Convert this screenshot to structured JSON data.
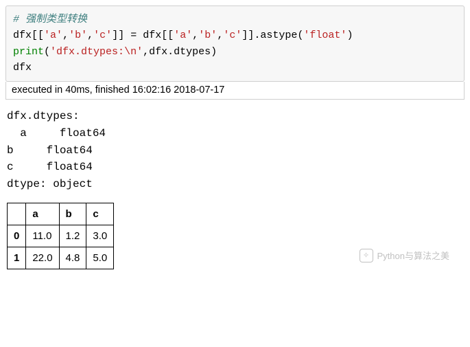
{
  "code": {
    "comment": "# 强制类型转换",
    "line2_pre": "dfx[[",
    "q": "'",
    "a": "a",
    "b": "b",
    "c": "c",
    "sep": ",",
    "line2_mid": "]] = dfx[[",
    "line2_end": "]].astype(",
    "float": "float",
    "rparen": ")",
    "print": "print",
    "lparen": "(",
    "str1": "dfx.dtypes:\\n",
    "comma_arg": ",dfx.dtypes)",
    "line4": "dfx"
  },
  "exec_status": "executed in 40ms, finished 16:02:16 2018-07-17",
  "output_text": "dfx.dtypes:\n  a     float64\nb     float64\nc     float64\ndtype: object",
  "chart_data": {
    "type": "table",
    "columns": [
      "a",
      "b",
      "c"
    ],
    "index": [
      "0",
      "1"
    ],
    "rows": [
      [
        "11.0",
        "1.2",
        "3.0"
      ],
      [
        "22.0",
        "4.8",
        "5.0"
      ]
    ]
  },
  "watermark": "Python与算法之美"
}
